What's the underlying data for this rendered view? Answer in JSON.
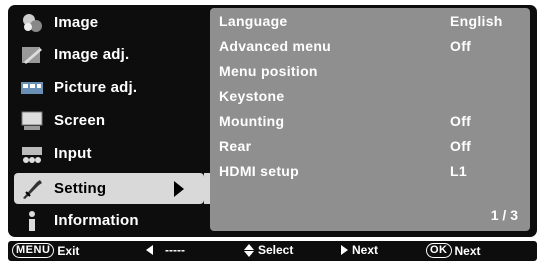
{
  "sidebar": {
    "items": [
      {
        "label": "Image",
        "icon": "image-icon"
      },
      {
        "label": "Image adj.",
        "icon": "image-adj-icon"
      },
      {
        "label": "Picture adj.",
        "icon": "picture-adj-icon"
      },
      {
        "label": "Screen",
        "icon": "screen-icon"
      },
      {
        "label": "Input",
        "icon": "input-icon"
      },
      {
        "label": "Setting",
        "icon": "setting-icon",
        "selected": true
      },
      {
        "label": "Information",
        "icon": "information-icon"
      }
    ]
  },
  "panel": {
    "rows": [
      {
        "label": "Language",
        "value": "English"
      },
      {
        "label": "Advanced menu",
        "value": "Off"
      },
      {
        "label": "Menu position",
        "value": ""
      },
      {
        "label": "Keystone",
        "value": ""
      },
      {
        "label": "Mounting",
        "value": "Off"
      },
      {
        "label": "Rear",
        "value": "Off"
      },
      {
        "label": "HDMI setup",
        "value": "L1"
      }
    ],
    "page_indicator": "1 / 3"
  },
  "footer": {
    "menu_key": "MENU",
    "exit_label": "Exit",
    "left_label": "-----",
    "select_label": "Select",
    "next_label": "Next",
    "ok_key": "OK",
    "ok_next_label": "Next"
  },
  "colors": {
    "background": "#0d0d0d",
    "panel": "#8f8f8f",
    "selected": "#d9d9d9",
    "text": "#ffffff"
  }
}
